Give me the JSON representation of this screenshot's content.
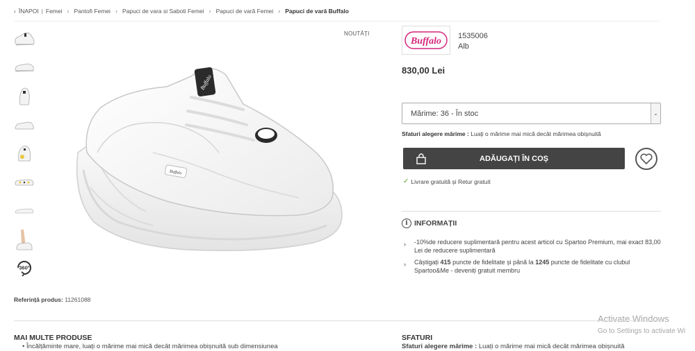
{
  "breadcrumb": {
    "back": "ÎNAPOI",
    "items": [
      "Femei",
      "Pantofi Femei",
      "Papuci de vara si Saboti Femei",
      "Papuci de vară Femei",
      "Papuci de vară Buffalo"
    ]
  },
  "badge": {
    "new": "NOUTĂȚI"
  },
  "product": {
    "brand_logo_text": "Buffalo",
    "sku": "1535006",
    "color": "Alb",
    "price": "830,00 Lei",
    "reference_label": "Referință produs:",
    "reference_value": "11261088"
  },
  "size": {
    "selected": "Mărime: 36 - În stoc",
    "advice_label": "Sfaturi alegere mărime :",
    "advice_text": "Luați o mărime mai mică decât mărimea obișnuită"
  },
  "cart": {
    "add_label": "ADĂUGAȚI ÎN COȘ"
  },
  "delivery": {
    "text": "Livrare gratuită și Retur gratuit"
  },
  "info": {
    "title": "INFORMAȚII",
    "item1": "-10%de reducere suplimentară pentru acest articol cu Spartoo Premium, mai exact 83,00 Lei de reducere suplimentară",
    "item2_a": "Câștigați",
    "item2_b": "415",
    "item2_c": "puncte de fidelitate  și până la",
    "item2_d": "1245",
    "item2_e": "puncte de fidelitate cu clubul Spartoo&Me - deveniți gratuit membru"
  },
  "more": {
    "title": "MAI MULTE PRODUSE",
    "item": "• Încălțăminte mare, luați o mărime mai mică decât mărimea obișnuită sub dimensiunea"
  },
  "advice": {
    "title": "SFATURI",
    "label": "Sfaturi alegere mărime :",
    "text": "Luați o mărime mai mică decât mărimea obișnuită"
  },
  "watermark": {
    "line1": "Activate Windows",
    "line2": "Go to Settings to activate Wi"
  },
  "thumbnails": {
    "label_360": "360°"
  },
  "colors": {
    "button_dark": "#444444",
    "brand_pink": "#d4257a",
    "check_green": "#5aa02c"
  }
}
